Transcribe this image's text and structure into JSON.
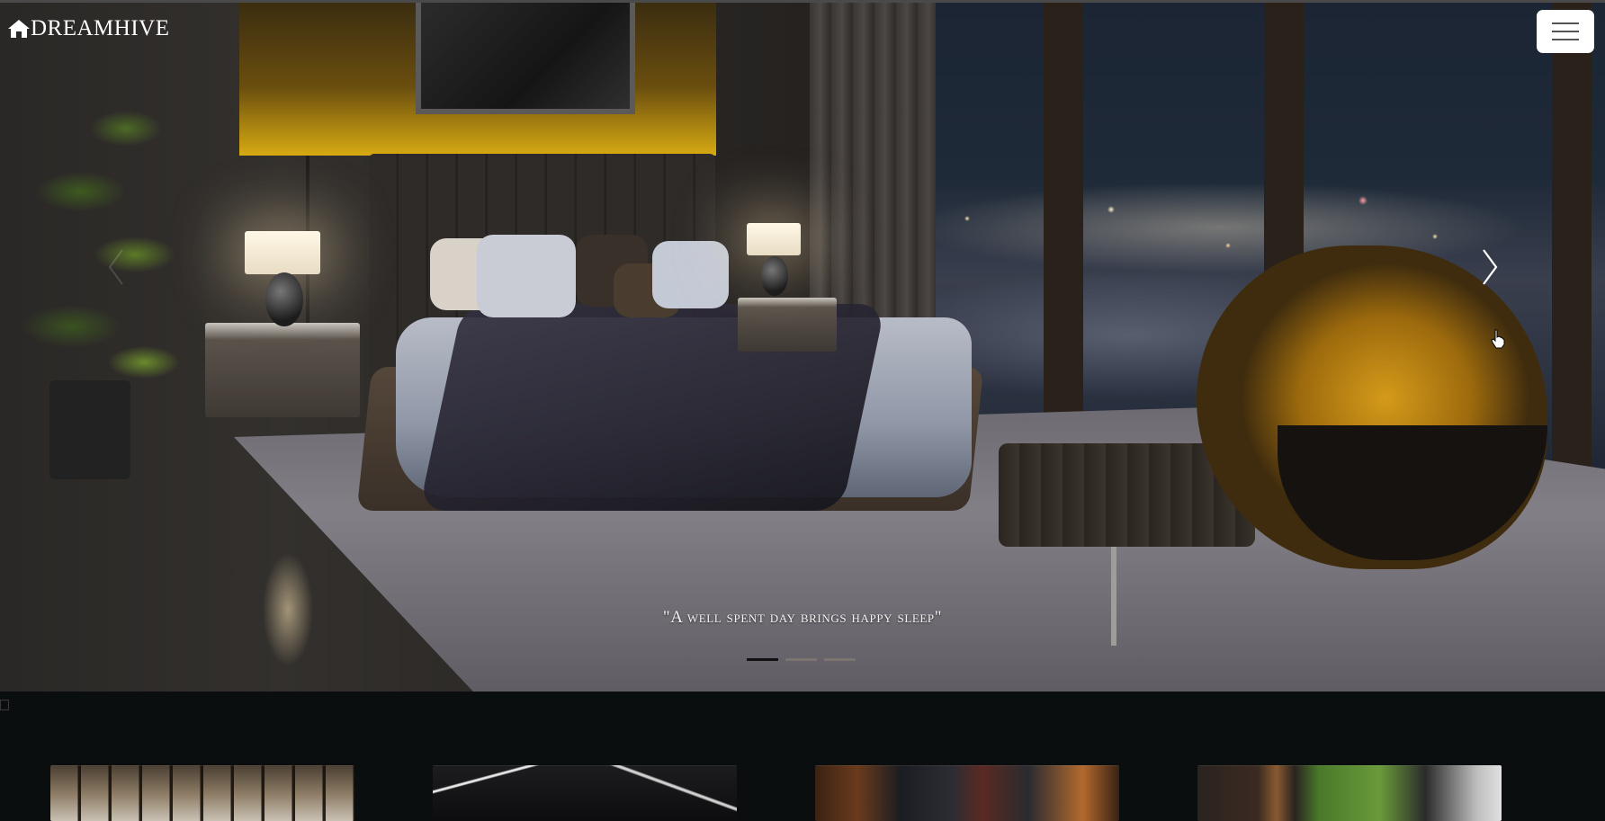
{
  "navbar": {
    "brand_name": "DREAMHIVE",
    "brand_icon": "home-icon",
    "menu_icon": "hamburger-menu-icon"
  },
  "carousel": {
    "caption": "\"A well spent day brings happy sleep\"",
    "slide_count": 3,
    "active_slide": 1,
    "prev_icon": "chevron-left-icon",
    "next_icon": "chevron-right-icon"
  },
  "cards": [
    {
      "image": "ceiling-beams-lounge"
    },
    {
      "image": "dark-room-light-strips"
    },
    {
      "image": "rust-art-gallery-room"
    },
    {
      "image": "green-wall-interior"
    }
  ],
  "colors": {
    "brand_text": "#ffffff",
    "page_background": "#0a0d0d",
    "toggle_background": "#ffffff",
    "indicator_active": "#111111",
    "indicator_inactive": "#7c7470"
  }
}
